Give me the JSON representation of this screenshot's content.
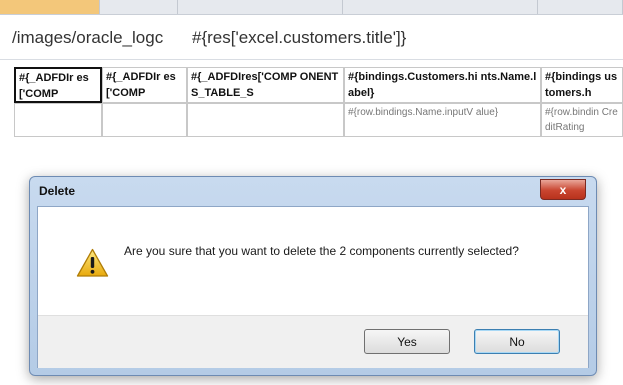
{
  "page": {
    "title_left": "/images/oracle_logc",
    "title_right": "#{res['excel.customers.title']}"
  },
  "table": {
    "headers": [
      "#{_ADFDIr es['COMP",
      "#{_ADFDIr es['COMP",
      "#{_ADFDIres['COMP ONENTS_TABLE_S",
      "#{bindings.Customers.hi nts.Name.label}",
      "#{bindings ustomers.h"
    ],
    "rows": [
      [
        "",
        "",
        "",
        "#{row.bindings.Name.inputV alue}",
        "#{row.bindin CreditRating"
      ]
    ]
  },
  "dialog": {
    "title": "Delete",
    "close_label": "x",
    "message": "Are you sure that you want to delete the 2 components currently selected?",
    "yes_label": "Yes",
    "no_label": "No",
    "icon": "warning-icon"
  },
  "colors": {
    "warning": "#f0c21b",
    "dialog_frame": "#b4cbe6",
    "close_red": "#c9452f"
  }
}
